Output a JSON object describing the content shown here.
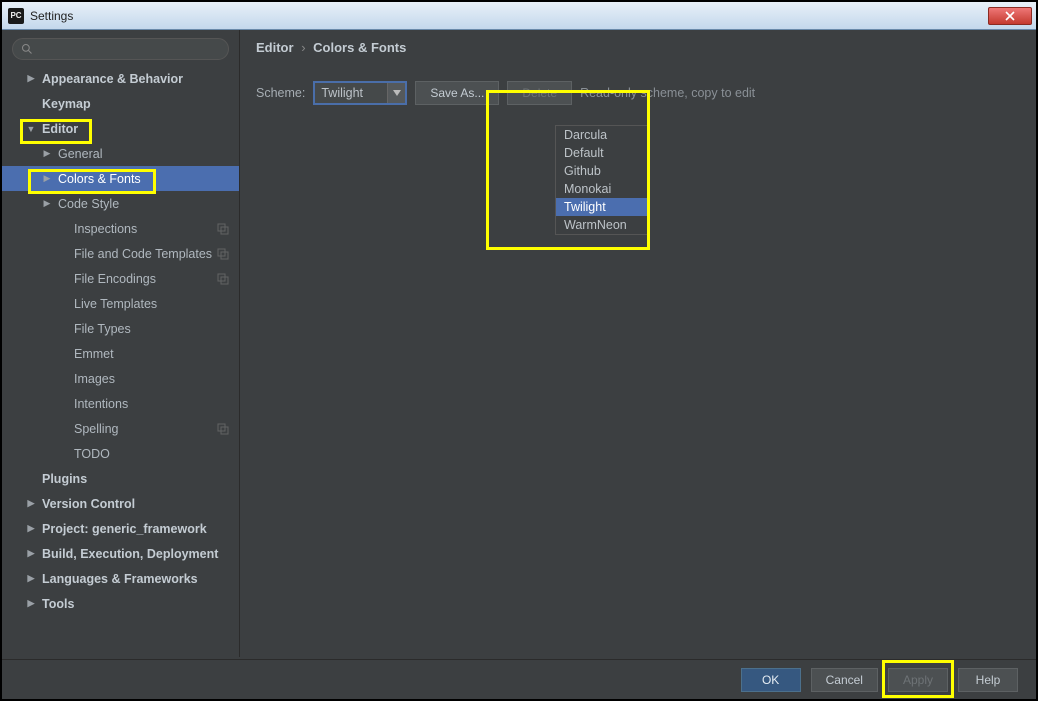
{
  "window": {
    "title": "Settings",
    "app_icon_text": "PC"
  },
  "search": {
    "placeholder": ""
  },
  "sidebar": {
    "items": [
      {
        "label": "Appearance & Behavior",
        "bold": true,
        "level": 0,
        "arrow": "right"
      },
      {
        "label": "Keymap",
        "bold": true,
        "level": 0
      },
      {
        "label": "Editor",
        "bold": true,
        "level": 0,
        "arrow": "down",
        "highlight": true
      },
      {
        "label": "General",
        "level": 1,
        "arrow": "right"
      },
      {
        "label": "Colors & Fonts",
        "level": 1,
        "arrow": "right",
        "selected": true,
        "highlight": true
      },
      {
        "label": "Code Style",
        "level": 1,
        "arrow": "right"
      },
      {
        "label": "Inspections",
        "level": 2,
        "copy": true
      },
      {
        "label": "File and Code Templates",
        "level": 2,
        "copy": true
      },
      {
        "label": "File Encodings",
        "level": 2,
        "copy": true
      },
      {
        "label": "Live Templates",
        "level": 2
      },
      {
        "label": "File Types",
        "level": 2
      },
      {
        "label": "Emmet",
        "level": 2
      },
      {
        "label": "Images",
        "level": 2
      },
      {
        "label": "Intentions",
        "level": 2
      },
      {
        "label": "Spelling",
        "level": 2,
        "copy": true
      },
      {
        "label": "TODO",
        "level": 2
      },
      {
        "label": "Plugins",
        "bold": true,
        "level": 0
      },
      {
        "label": "Version Control",
        "bold": true,
        "level": 0,
        "arrow": "right"
      },
      {
        "label": "Project: generic_framework",
        "bold": true,
        "level": 0,
        "arrow": "right"
      },
      {
        "label": "Build, Execution, Deployment",
        "bold": true,
        "level": 0,
        "arrow": "right"
      },
      {
        "label": "Languages & Frameworks",
        "bold": true,
        "level": 0,
        "arrow": "right"
      },
      {
        "label": "Tools",
        "bold": true,
        "level": 0,
        "arrow": "right"
      }
    ]
  },
  "breadcrumb": {
    "parent": "Editor",
    "sep": "›",
    "current": "Colors & Fonts"
  },
  "scheme": {
    "label": "Scheme:",
    "value": "Twilight",
    "options": [
      "Darcula",
      "Default",
      "Github",
      "Monokai",
      "Twilight",
      "WarmNeon"
    ],
    "save_as": "Save As...",
    "delete": "Delete",
    "hint": "Read-only scheme, copy to edit"
  },
  "footer": {
    "ok": "OK",
    "cancel": "Cancel",
    "apply": "Apply",
    "help": "Help"
  }
}
